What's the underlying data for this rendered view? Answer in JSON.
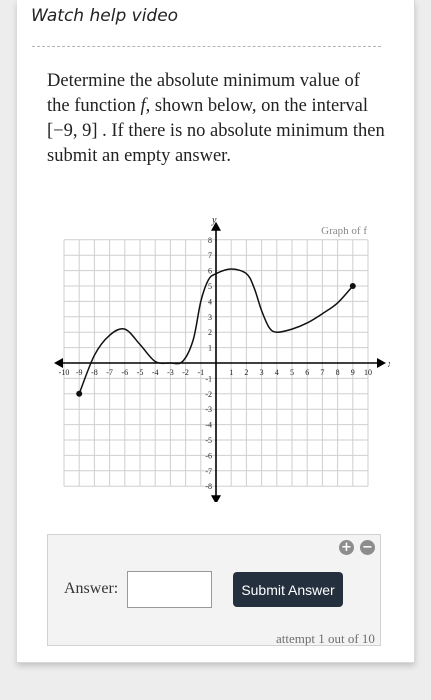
{
  "help": {
    "label": "Watch help video"
  },
  "question": {
    "text_part1": "Determine the absolute minimum value of the function ",
    "func_symbol": "f",
    "text_part2": ", shown below, on the interval ",
    "interval": "[−9, 9]",
    "text_part3": " . If there is no absolute minimum then submit an empty answer."
  },
  "chart_data": {
    "type": "line",
    "title": "Graph of f",
    "xlabel": "x",
    "ylabel": "y",
    "xlim": [
      -10,
      10
    ],
    "ylim": [
      -8,
      8
    ],
    "grid": true,
    "xticks": [
      -10,
      -9,
      -8,
      -7,
      -6,
      -5,
      -4,
      -3,
      -2,
      -1,
      1,
      2,
      3,
      4,
      5,
      6,
      7,
      8,
      9,
      10
    ],
    "yticks": [
      -8,
      -7,
      -6,
      -5,
      -4,
      -3,
      -2,
      -1,
      1,
      2,
      3,
      4,
      5,
      6,
      7,
      8
    ],
    "series": [
      {
        "points": [
          [
            -9,
            -2
          ],
          [
            -8,
            0.5
          ],
          [
            -7,
            1.8
          ],
          [
            -6,
            2.2
          ],
          [
            -5,
            1.2
          ],
          [
            -4,
            0.1
          ],
          [
            -3,
            0
          ],
          [
            -2.2,
            0.1
          ],
          [
            -1.5,
            1.5
          ],
          [
            -1,
            4
          ],
          [
            -0.5,
            5.4
          ],
          [
            0,
            5.8
          ],
          [
            1,
            6.1
          ],
          [
            2,
            5.8
          ],
          [
            2.5,
            4.9
          ],
          [
            3,
            3.4
          ],
          [
            3.5,
            2.3
          ],
          [
            4,
            2
          ],
          [
            5,
            2.2
          ],
          [
            6,
            2.6
          ],
          [
            7,
            3.2
          ],
          [
            8,
            3.9
          ],
          [
            9,
            5
          ]
        ],
        "endpoints": [
          [
            -9,
            -2
          ],
          [
            9,
            5
          ]
        ]
      }
    ]
  },
  "answer": {
    "label": "Answer:",
    "value": "",
    "placeholder": "",
    "plus_glyph": "+",
    "minus_glyph": "−"
  },
  "submit": {
    "label": "Submit Answer"
  },
  "attempt": {
    "text": "attempt 1 out of 10"
  },
  "colors": {
    "button_bg": "#24303e",
    "grid": "#cfcfcf",
    "axis": "#000000"
  }
}
